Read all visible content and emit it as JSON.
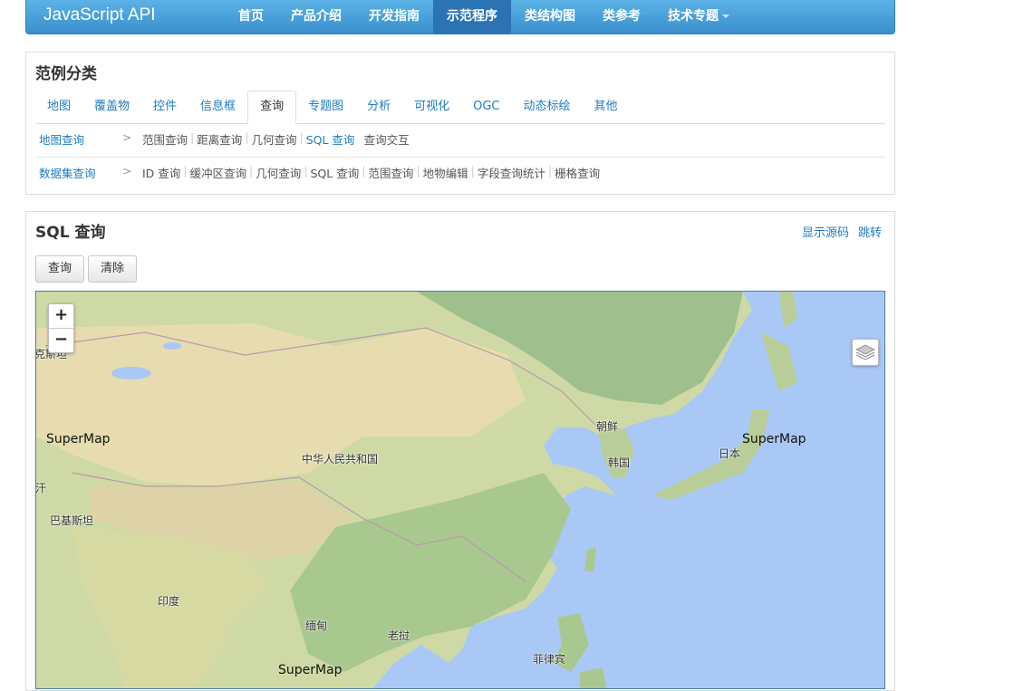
{
  "navbar": {
    "brand": "JavaScript API",
    "items": [
      "首页",
      "产品介绍",
      "开发指南",
      "示范程序",
      "类结构图",
      "类参考",
      "技术专题"
    ],
    "active_index": 3,
    "accent": "#3a8fcd"
  },
  "category": {
    "title": "范例分类",
    "tabs": [
      "地图",
      "覆盖物",
      "控件",
      "信息框",
      "查询",
      "专题图",
      "分析",
      "可视化",
      "OGC",
      "动态标绘",
      "其他"
    ],
    "active_tab": "查询",
    "rows": [
      {
        "head": "地图查询",
        "sep": ">",
        "links": [
          "范围查询",
          "距离查询",
          "几何查询",
          "SQL 查询",
          "查询交互"
        ],
        "current": "SQL 查询"
      },
      {
        "head": "数据集查询",
        "sep": ">",
        "links": [
          "ID 查询",
          "缓冲区查询",
          "几何查询",
          "SQL 查询",
          "范围查询",
          "地物编辑",
          "字段查询统计",
          "栅格查询"
        ]
      }
    ]
  },
  "demo": {
    "title": "SQL 查询",
    "show_source": "显示源码",
    "jump": "跳转",
    "query_button": "查询",
    "clear_button": "清除"
  },
  "map": {
    "zoom_in": "+",
    "zoom_out": "−",
    "labels": {
      "kazakhstan_partial": "克斯坦",
      "afghanistan_partial": "汗",
      "pakistan": "巴基斯坦",
      "china": "中华人民共和国",
      "north_korea": "朝鲜",
      "south_korea": "韩国",
      "japan": "日本",
      "india": "印度",
      "myanmar": "缅甸",
      "laos": "老挝",
      "philippines": "菲律宾"
    },
    "watermark": "SuperMap",
    "icons": [
      "layers-icon"
    ]
  }
}
